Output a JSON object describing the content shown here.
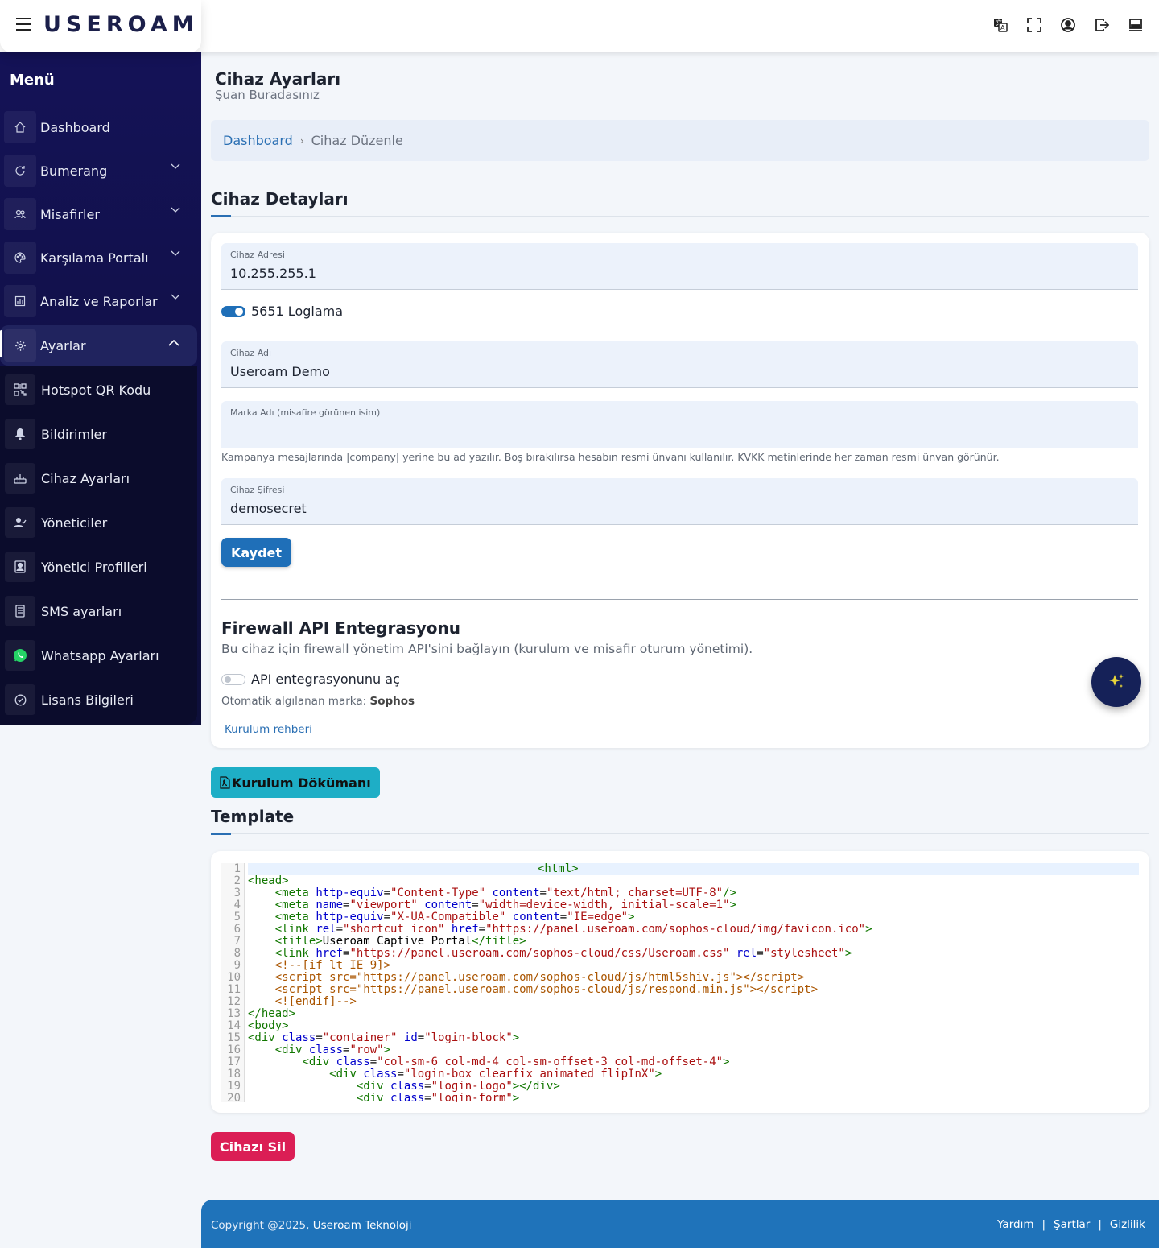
{
  "header": {
    "logo_text": "USEROAM",
    "icons": [
      "translate-icon",
      "fullscreen-icon",
      "user-circle-icon",
      "logout-icon",
      "laptop-icon"
    ]
  },
  "sidebar": {
    "title": "Menü",
    "items": [
      {
        "label": "Dashboard",
        "icon": "home-icon"
      },
      {
        "label": "Bumerang",
        "icon": "refresh-icon"
      },
      {
        "label": "Misafirler",
        "icon": "users-icon"
      },
      {
        "label": "Karşılama Portalı",
        "icon": "palette-icon"
      },
      {
        "label": "Analiz ve Raporlar",
        "icon": "chart-icon"
      },
      {
        "label": "Ayarlar",
        "icon": "gear-icon"
      }
    ],
    "subitems": [
      {
        "label": "Hotspot QR Kodu",
        "icon": "qr-icon"
      },
      {
        "label": "Bildirimler",
        "icon": "bell-icon"
      },
      {
        "label": "Cihaz Ayarları",
        "icon": "router-icon"
      },
      {
        "label": "Yöneticiler",
        "icon": "user-check-icon"
      },
      {
        "label": "Yönetici Profilleri",
        "icon": "portrait-icon"
      },
      {
        "label": "SMS ayarları",
        "icon": "sms-icon"
      },
      {
        "label": "Whatsapp Ayarları",
        "icon": "whatsapp-icon"
      },
      {
        "label": "Lisans Bilgileri",
        "icon": "check-circle-icon"
      }
    ]
  },
  "page": {
    "title": "Cihaz Ayarları",
    "subtitle": "Şuan Buradasınız",
    "breadcrumb": {
      "home": "Dashboard",
      "current": "Cihaz Düzenle"
    }
  },
  "details": {
    "heading": "Cihaz Detayları",
    "address_label": "Cihaz Adresi",
    "address_value": "10.255.255.1",
    "logging_label": "5651 Loglama",
    "logging_on": true,
    "name_label": "Cihaz Adı",
    "name_value": "Useroam Demo",
    "brand_label": "Marka Adı (misafire görünen isim)",
    "brand_value": "",
    "brand_help": "Kampanya mesajlarında |company| yerine bu ad yazılır. Boş bırakılırsa hesabın resmi ünvanı kullanılır. KVKK metinlerinde her zaman resmi ünvan görünür.",
    "password_label": "Cihaz Şifresi",
    "password_value": "demosecret",
    "save_label": "Kaydet"
  },
  "firewall": {
    "title": "Firewall API Entegrasyonu",
    "description": "Bu cihaz için firewall yönetim API'sini bağlayın (kurulum ve misafir oturum yönetimi).",
    "toggle_label": "API entegrasyonunu aç",
    "toggle_on": false,
    "detected_prefix": "Otomatik algılanan marka:",
    "detected_brand": "Sophos",
    "guide_link": "Kurulum rehberi"
  },
  "doc_button": "Kurulum Dökümanı",
  "template": {
    "heading": "Template",
    "lines": [
      "1",
      "2",
      "3",
      "4",
      "5",
      "6",
      "7",
      "8",
      "9",
      "10",
      "11",
      "12",
      "13",
      "14",
      "15",
      "16",
      "17",
      "18",
      "19",
      "20"
    ]
  },
  "delete_button": "Cihazı Sil",
  "footer": {
    "copyright": "Copyright @2025,",
    "company": "Useroam Teknoloji",
    "links": [
      "Yardım",
      "Şartlar",
      "Gizlilik"
    ],
    "separator": "|"
  },
  "colors": {
    "sidebar": "#141257",
    "primary": "#1f6fb8",
    "danger": "#db1e55",
    "info": "#1eaec6"
  }
}
